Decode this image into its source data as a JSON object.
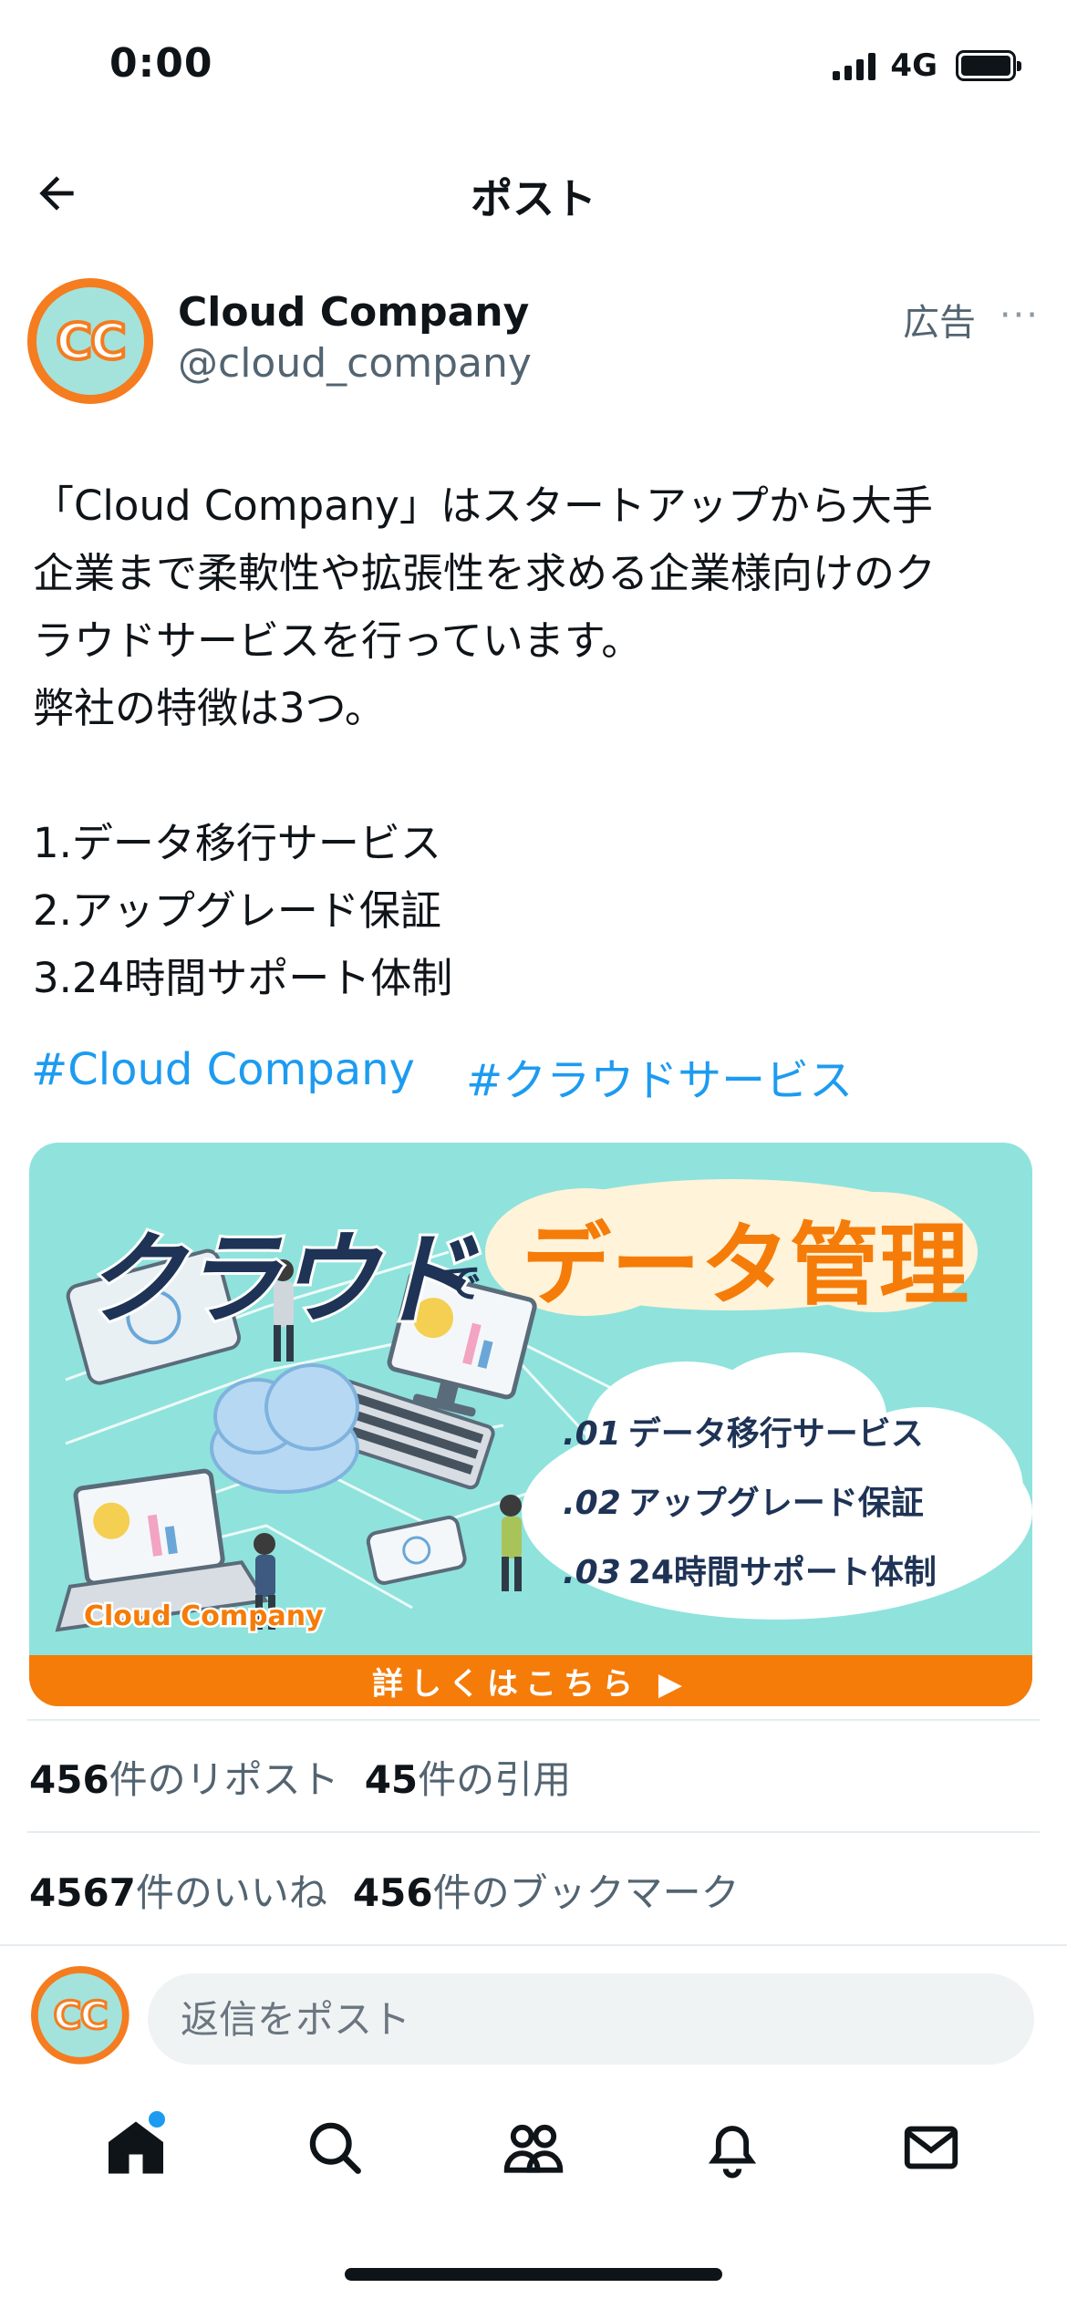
{
  "status_bar": {
    "time": "0:00",
    "network": "4G"
  },
  "header": {
    "title": "ポスト"
  },
  "author": {
    "name": "Cloud Company",
    "handle": "@cloud_company",
    "avatar_text": "CC",
    "ad_label": "広告",
    "more": "···"
  },
  "post": {
    "lines": [
      "「Cloud Company」はスタートアップから大手",
      "企業まで柔軟性や拡張性を求める企業様向けのク",
      "ラウドサービスを行っています。",
      "弊社の特徴は3つ。",
      "",
      "1.データ移行サービス",
      "2.アップグレード保証",
      "3.24時間サポート体制"
    ],
    "hashtags": [
      "#Cloud Company",
      "#クラウドサービス"
    ]
  },
  "banner": {
    "headline": "クラウド",
    "connector": "で",
    "tagline": "データ管理",
    "features": [
      {
        "num": ".01",
        "label": "データ移行サービス"
      },
      {
        "num": ".02",
        "label": "アップグレード保証"
      },
      {
        "num": ".03",
        "label": "24時間サポート体制"
      }
    ],
    "brand": "Cloud Company",
    "cta": "詳しくはこちら ▶",
    "colors": {
      "background": "#8fe3dc",
      "accent": "#f57c09",
      "navy": "#1e3355"
    }
  },
  "stats": {
    "reposts_count": "456",
    "reposts_label": "件のリポスト",
    "quotes_count": "45",
    "quotes_label": "件の引用",
    "likes_count": "4567",
    "likes_label": "件のいいね",
    "bookmarks_count": "456",
    "bookmarks_label": "件のブックマーク"
  },
  "reply": {
    "placeholder": "返信をポスト"
  },
  "nav": {
    "items": [
      "home-icon",
      "search-icon",
      "communities-icon",
      "notifications-icon",
      "messages-icon"
    ],
    "accent": "#1d9bf0"
  }
}
